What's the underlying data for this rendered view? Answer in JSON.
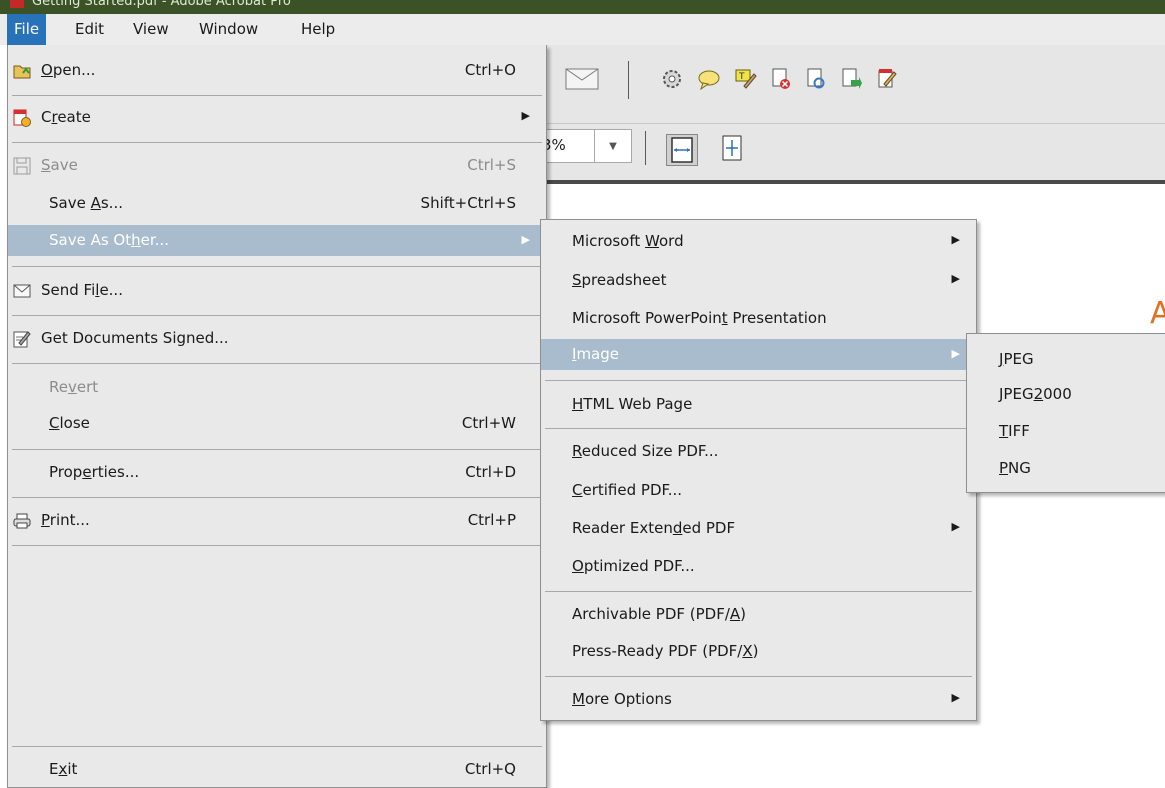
{
  "window": {
    "title": "Getting Started.pdf - Adobe Acrobat Pro"
  },
  "menubar": {
    "items": [
      "File",
      "Edit",
      "View",
      "Window",
      "Help"
    ],
    "active": "File"
  },
  "toolbar": {
    "zoom_value": "3%",
    "icons": [
      "email-icon",
      "gear-icon",
      "comment-icon",
      "highlight-icon",
      "delete-page-icon",
      "rotate-page-icon",
      "extract-page-icon",
      "edit-pdf-icon",
      "fit-width-icon",
      "fit-page-icon"
    ]
  },
  "file_menu": {
    "items": [
      {
        "pre": "",
        "m": "O",
        "post": "pen...",
        "shortcut": "Ctrl+O"
      },
      {
        "pre": "C",
        "m": "r",
        "post": "eate",
        "shortcut": ""
      },
      {
        "pre": "",
        "m": "S",
        "post": "ave",
        "shortcut": "Ctrl+S"
      },
      {
        "pre": "Save ",
        "m": "A",
        "post": "s...",
        "shortcut": "Shift+Ctrl+S"
      },
      {
        "pre": "Save As Ot",
        "m": "h",
        "post": "er...",
        "shortcut": ""
      },
      {
        "pre": "Send Fi",
        "m": "l",
        "post": "e...",
        "shortcut": ""
      },
      {
        "pre": "Get Documents Signed...",
        "m": "",
        "post": "",
        "shortcut": ""
      },
      {
        "pre": "Re",
        "m": "v",
        "post": "ert",
        "shortcut": ""
      },
      {
        "pre": "",
        "m": "C",
        "post": "lose",
        "shortcut": "Ctrl+W"
      },
      {
        "pre": "Prop",
        "m": "e",
        "post": "rties...",
        "shortcut": "Ctrl+D"
      },
      {
        "pre": "",
        "m": "P",
        "post": "rint...",
        "shortcut": "Ctrl+P"
      },
      {
        "pre": "E",
        "m": "x",
        "post": "it",
        "shortcut": "Ctrl+Q"
      }
    ]
  },
  "save_as_other_menu": {
    "items": [
      {
        "pre": "Microsoft ",
        "m": "W",
        "post": "ord"
      },
      {
        "pre": "",
        "m": "S",
        "post": "preadsheet"
      },
      {
        "pre": "Microsoft PowerPoin",
        "m": "t",
        "post": " Presentation"
      },
      {
        "pre": "",
        "m": "I",
        "post": "mage"
      },
      {
        "pre": "",
        "m": "H",
        "post": "TML Web Page"
      },
      {
        "pre": "",
        "m": "R",
        "post": "educed Size PDF..."
      },
      {
        "pre": "",
        "m": "C",
        "post": "ertified PDF..."
      },
      {
        "pre": "Reader Exten",
        "m": "d",
        "post": "ed PDF"
      },
      {
        "pre": "",
        "m": "O",
        "post": "ptimized PDF..."
      },
      {
        "pre": "Archivable PDF (PDF/",
        "m": "A",
        "post": ")"
      },
      {
        "pre": "Press-Ready PDF (PDF/",
        "m": "X",
        "post": ")"
      },
      {
        "pre": "",
        "m": "M",
        "post": "ore Options"
      }
    ]
  },
  "image_menu": {
    "items": [
      {
        "pre": "",
        "m": "J",
        "post": "PEG"
      },
      {
        "pre": "JPEG",
        "m": "2",
        "post": "000"
      },
      {
        "pre": "",
        "m": "T",
        "post": "IFF"
      },
      {
        "pre": "",
        "m": "P",
        "post": "NG"
      }
    ]
  },
  "document": {
    "visible_fragment": "A"
  },
  "colors": {
    "menu_highlight": "#a8bccd",
    "menubar_active": "#2872ba",
    "titlebar": "#3a5226",
    "doc_accent": "#e07020"
  }
}
